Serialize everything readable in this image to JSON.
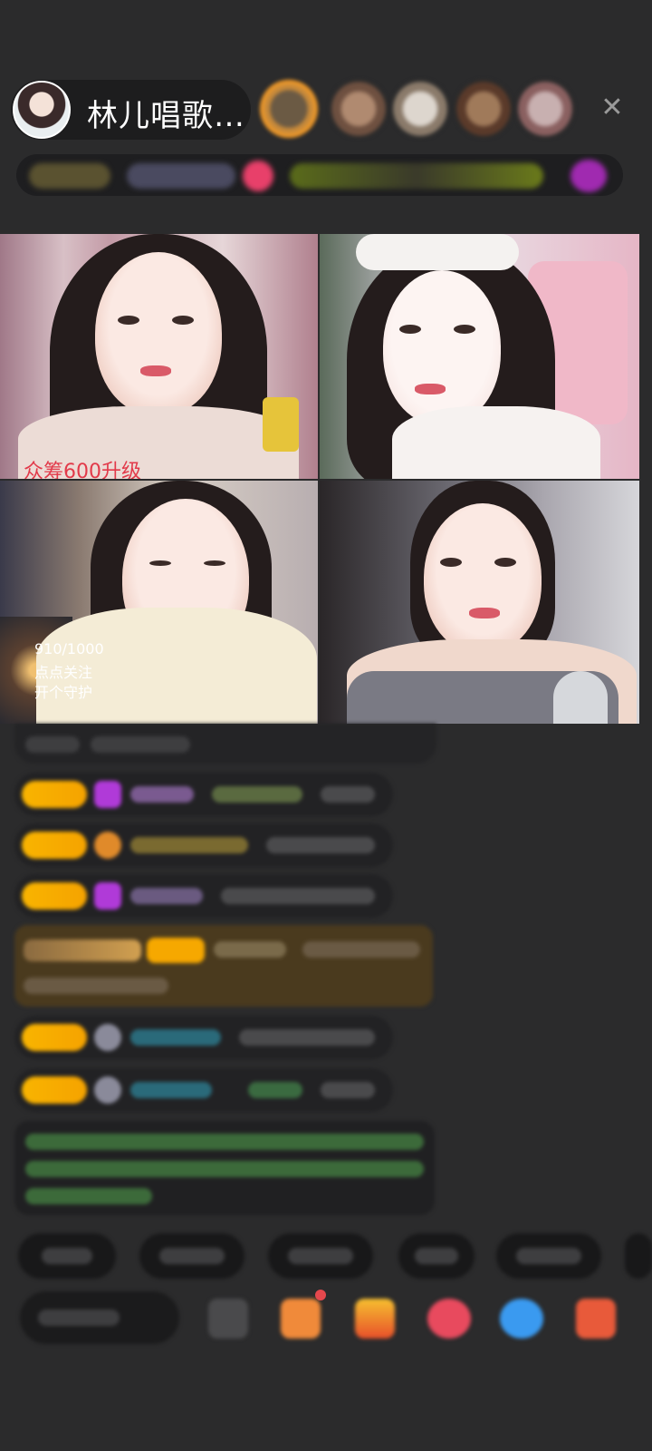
{
  "header": {
    "host_name": "林儿唱歌…",
    "close_icon": "close-icon",
    "viewers": [
      {
        "color": "#8a6a40",
        "frame": "#f29a28"
      },
      {
        "color": "#9a7a60",
        "frame": ""
      },
      {
        "color": "#b8b0a8",
        "frame": ""
      },
      {
        "color": "#7a5a40",
        "frame": ""
      },
      {
        "color": "#a89090",
        "frame": ""
      }
    ]
  },
  "tiles": {
    "t1_label": "众筹600升级",
    "t3_progress": "910/1000",
    "t3_follow": "点点关注",
    "t3_guard": "开个守护"
  },
  "colors": {
    "badge": "#f6a800",
    "accent_red": "#e5484d",
    "bg": "#2b2b2c"
  }
}
